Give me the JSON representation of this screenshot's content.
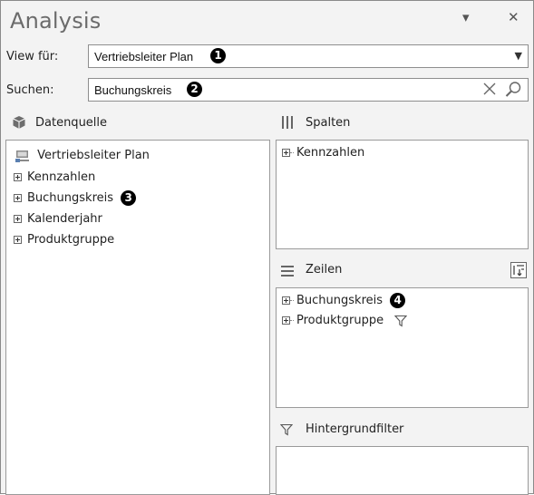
{
  "title": "Analysis",
  "title_buttons": {
    "dropdown": "▾",
    "close": "✕"
  },
  "view": {
    "label": "View für:",
    "value": "Vertriebsleiter Plan",
    "badge": "1"
  },
  "search": {
    "label": "Suchen:",
    "value": "Buchungskreis",
    "badge": "2"
  },
  "datasource": {
    "label": "Datenquelle",
    "root": "Vertriebsleiter Plan",
    "items": [
      {
        "label": "Kennzahlen"
      },
      {
        "label": "Buchungskreis",
        "badge": "3"
      },
      {
        "label": "Kalenderjahr"
      },
      {
        "label": "Produktgruppe"
      }
    ]
  },
  "columns": {
    "label": "Spalten",
    "items": [
      {
        "label": "Kennzahlen"
      }
    ]
  },
  "rows": {
    "label": "Zeilen",
    "items": [
      {
        "label": "Buchungskreis",
        "badge": "4"
      },
      {
        "label": "Produktgruppe"
      }
    ]
  },
  "background_filter": {
    "label": "Hintergrundfilter"
  },
  "colors": {
    "badge": "#000000",
    "panel_bg": "#f3f3f3",
    "border": "#9a9a9a"
  }
}
